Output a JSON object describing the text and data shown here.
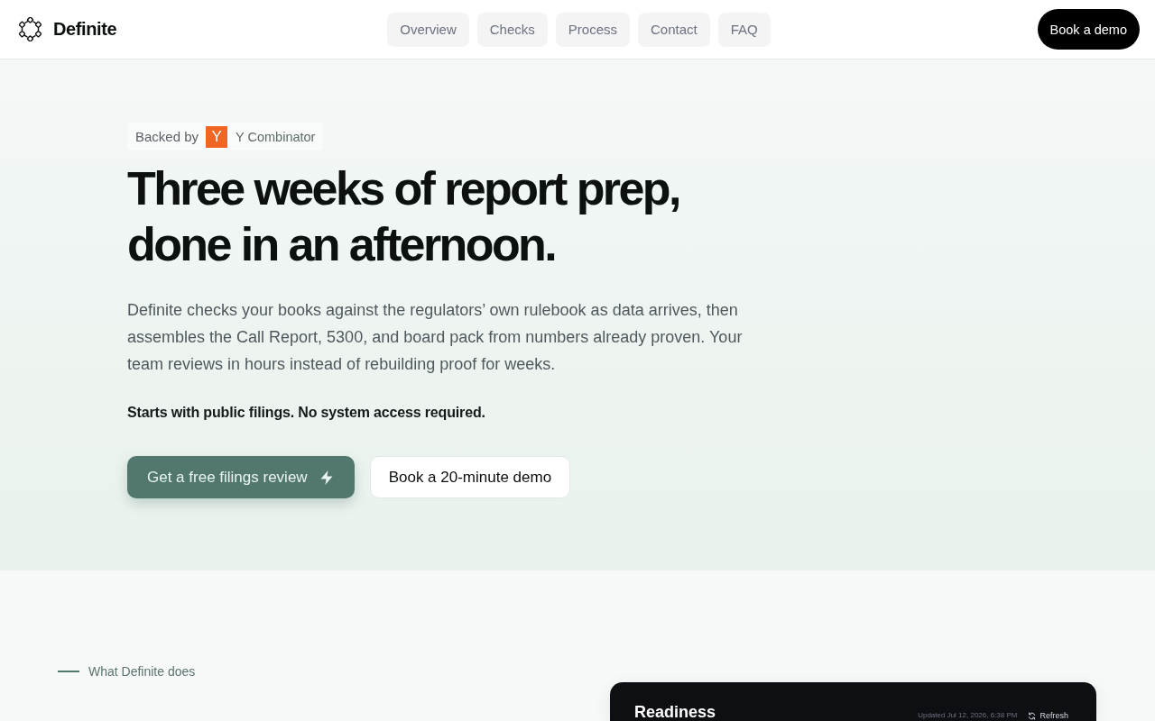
{
  "header": {
    "brand": "Definite",
    "nav": [
      {
        "label": "Overview"
      },
      {
        "label": "Checks"
      },
      {
        "label": "Process"
      },
      {
        "label": "Contact"
      },
      {
        "label": "FAQ"
      }
    ],
    "cta": "Book a demo"
  },
  "hero": {
    "badge": {
      "prefix": "Backed by",
      "logo_letter": "Y",
      "name": "Y Combinator"
    },
    "title": "Three weeks of report prep, done in an afternoon.",
    "description": "Definite checks your books against the regulators’ own rulebook as data arrives, then assembles the Call Report, 5300, and board pack from numbers already proven. Your team reviews in hours instead of rebuilding proof for weeks.",
    "note": "Starts with public filings. No system access required.",
    "buttons": [
      {
        "label": "Get a free filings review",
        "kind": "primary"
      },
      {
        "label": "Book a 20-minute demo",
        "kind": "secondary"
      }
    ]
  },
  "section": {
    "eyebrow": "What Definite does",
    "card": {
      "title": "Readiness",
      "updated": "Updated Jul 12, 2026, 6:38 PM",
      "action": "Refresh"
    }
  }
}
